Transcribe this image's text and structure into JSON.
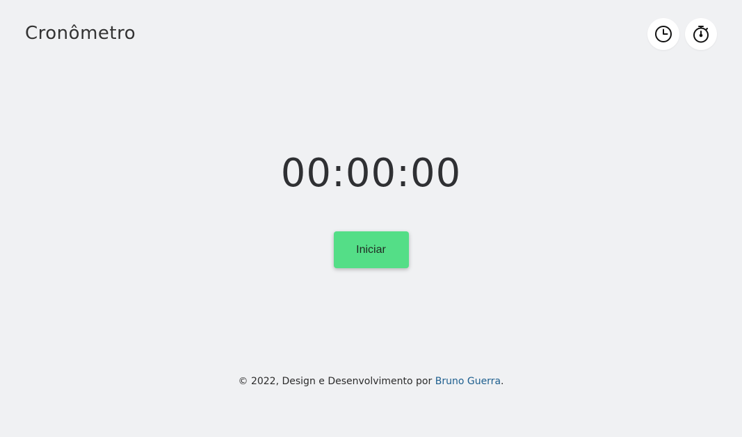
{
  "header": {
    "title": "Cronômetro",
    "nav": [
      {
        "name": "clock-icon"
      },
      {
        "name": "stopwatch-icon"
      }
    ]
  },
  "timer": {
    "display": "00:00:00",
    "start_label": "Iniciar"
  },
  "footer": {
    "text": "© 2022, Design e Desenvolvimento por ",
    "author": "Bruno Guerra",
    "suffix": "."
  },
  "colors": {
    "background": "#f0f1f3",
    "start_button": "#54de87",
    "link": "#1d5e8e"
  }
}
